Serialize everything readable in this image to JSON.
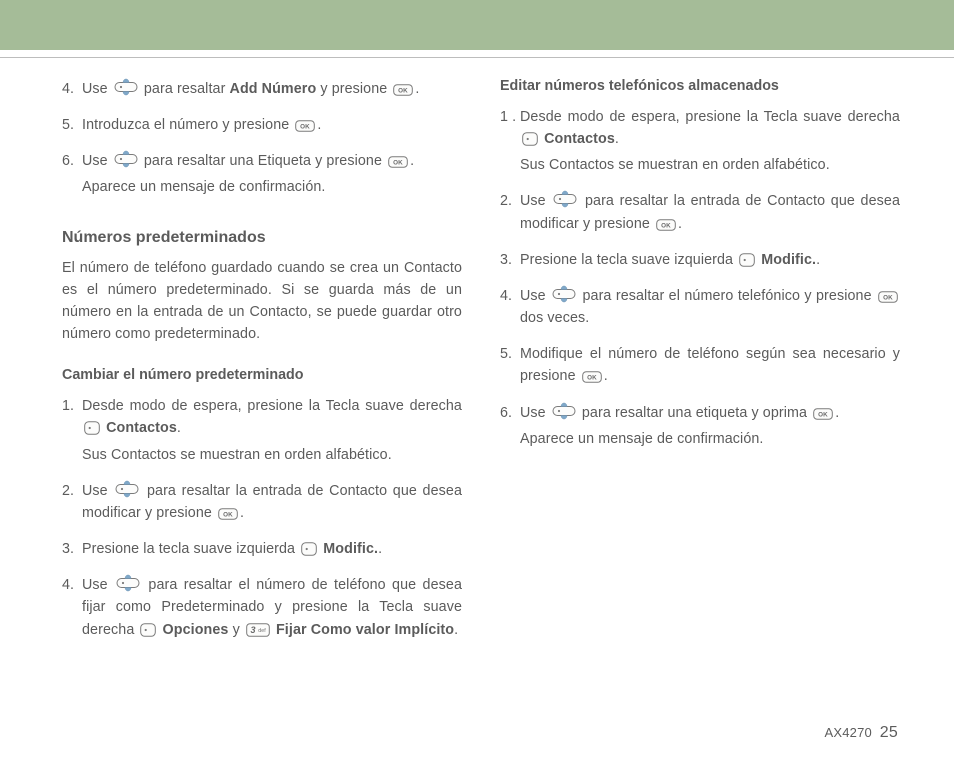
{
  "footer": {
    "model": "AX4270",
    "page": "25"
  },
  "left": {
    "s4_a": "Use ",
    "s4_b": " para resaltar ",
    "s4_bold": "Add Número",
    "s4_c": " y presione ",
    "s4_d": ".",
    "s5_a": "Introduzca el número y presione ",
    "s5_b": ".",
    "s6_a": "Use ",
    "s6_b": " para resaltar una Etiqueta y presione ",
    "s6_c": ".",
    "s6_sub": "Aparece un mensaje de confirmación.",
    "h_predet": "Números predeterminados",
    "p_predet": "El número de teléfono guardado cuando se crea un Contacto es el número predeterminado. Si se guarda más de un número en la entrada de un Contacto, se puede guardar otro número como predeterminado.",
    "h_change": "Cambiar el número predeterminado",
    "c1_a": "Desde modo de espera, presione la Tecla suave derecha ",
    "c1_bold": "Contactos",
    "c1_b": ".",
    "c1_sub": "Sus Contactos se muestran en orden alfabético.",
    "c2_a": "Use ",
    "c2_b": " para resaltar la entrada de Contacto que desea modificar y presione ",
    "c2_c": ".",
    "c3_a": "Presione la tecla suave izquierda ",
    "c3_bold": "Modific.",
    "c3_b": ".",
    "c4_a": "Use ",
    "c4_b": " para resaltar el número de teléfono que desea fijar como Predeterminado y presione la Tecla suave derecha ",
    "c4_bold1": "Opciones",
    "c4_c": " y ",
    "c4_bold2": "Fijar Como valor Implícito",
    "c4_d": "."
  },
  "right": {
    "h_edit": "Editar números telefónicos almacenados",
    "e1_a": "Desde modo de espera, presione la Tecla suave derecha ",
    "e1_bold": "Contactos",
    "e1_b": ".",
    "e1_sub": "Sus Contactos se muestran en orden alfabético.",
    "e2_a": "Use ",
    "e2_b": " para resaltar la entrada de Contacto que desea modificar y presione ",
    "e2_c": ".",
    "e3_a": "Presione la tecla suave izquierda ",
    "e3_bold": "Modific.",
    "e3_b": ".",
    "e4_a": "Use ",
    "e4_b": " para resaltar el número telefónico y presione ",
    "e4_c": " dos veces.",
    "e5_a": "Modifique el número de teléfono según sea necesario y presione ",
    "e5_b": ".",
    "e6_a": "Use ",
    "e6_b": " para resaltar una etiqueta y oprima ",
    "e6_c": ".",
    "e6_sub": "Aparece un mensaje de confirmación."
  }
}
